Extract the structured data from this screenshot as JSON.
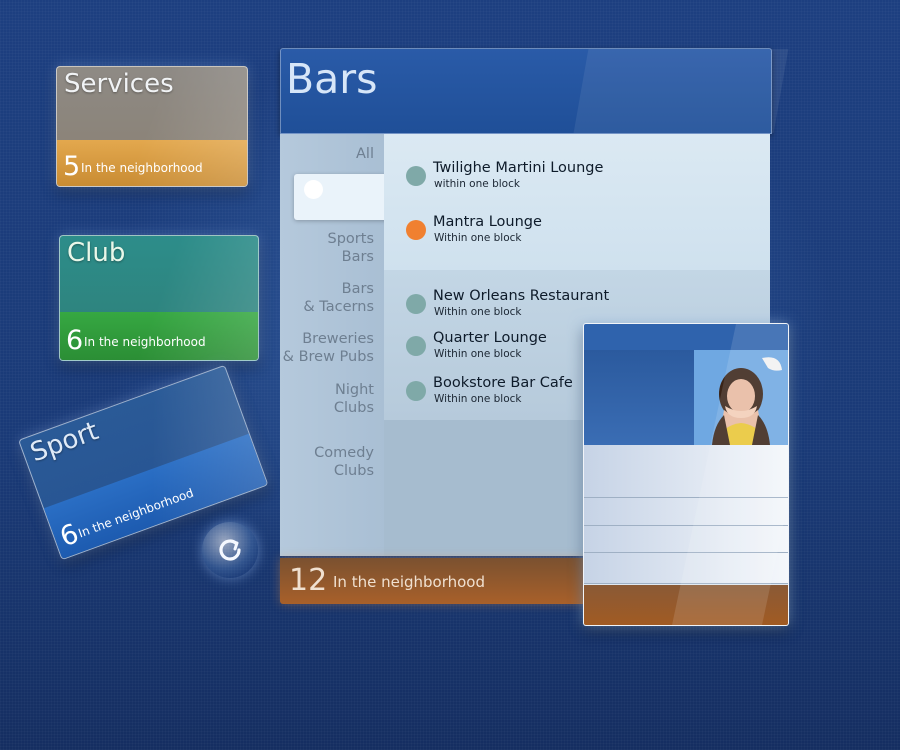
{
  "categories": [
    {
      "title": "Services",
      "count": "5",
      "count_text": "In the neighborhood",
      "color": "#e3a84e"
    },
    {
      "title": "Club",
      "count": "6",
      "count_text": "In the neighborhood",
      "color": "#36a842"
    },
    {
      "title": "Sport",
      "count": "6",
      "count_text": "In the neighborhood",
      "color": "#2a6ec4"
    }
  ],
  "refresh": {
    "icon": "refresh-icon"
  },
  "bars": {
    "title": "Bars",
    "filters": {
      "all": "All",
      "sports": "Sports\nBars",
      "bars": "Bars\n& Tacerns",
      "breweries": "Breweries\n& Brew Pubs",
      "night": "Night\nClubs",
      "comedy": "Comedy\nClubs"
    },
    "venues": [
      {
        "name": "Twilighe Martini Lounge",
        "distance": "within one block",
        "dot": "#7fa9a8"
      },
      {
        "name": "Mantra Lounge",
        "distance": "Within one block",
        "dot": "#f08030"
      },
      {
        "name": "New Orleans Restaurant",
        "distance": "Within one block",
        "dot": "#7fa9a8"
      },
      {
        "name": "Quarter Lounge",
        "distance": "Within one block",
        "dot": "#7fa9a8"
      },
      {
        "name": "Bookstore Bar Cafe",
        "distance": "Within one block",
        "dot": "#7fa9a8"
      }
    ],
    "footer": {
      "count": "12",
      "text": "In the neighborhood"
    }
  },
  "detail_card": {
    "photo": "person-photo"
  }
}
